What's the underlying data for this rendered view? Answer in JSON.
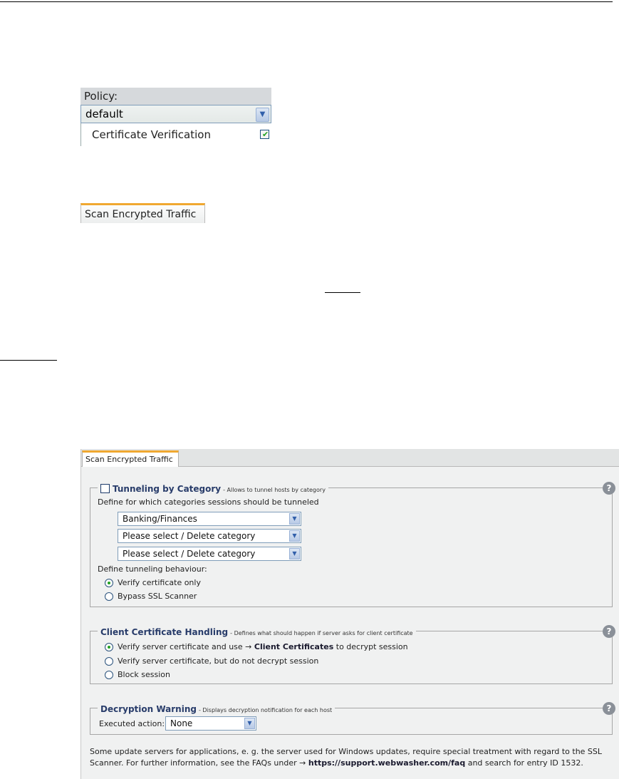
{
  "policy": {
    "header": "Policy:",
    "selected": "default",
    "row_label": "Certificate Verification",
    "row_checked": true
  },
  "small_tab": {
    "label": "Scan Encrypted Traffic"
  },
  "panel": {
    "tab_label": "Scan Encrypted Traffic",
    "tunneling": {
      "title": "Tunneling by Category",
      "desc": "- Allows to tunnel hosts by category",
      "checked": false,
      "define_label": "Define for which categories sessions should be tunneled",
      "categories": [
        "Banking/Finances",
        "Please select / Delete category",
        "Please select / Delete category"
      ],
      "behaviour_label": "Define tunneling behaviour:",
      "options": [
        {
          "label": "Verify certificate only",
          "selected": true
        },
        {
          "label": "Bypass SSL Scanner",
          "selected": false
        }
      ]
    },
    "client_cert": {
      "title": "Client Certificate Handling",
      "desc": "- Defines what should happen if server asks for client certificate",
      "option1_prefix": "Verify server certificate and use →",
      "option1_link": "Client Certificates",
      "option1_suffix": "to decrypt session",
      "option2": "Verify server certificate, but do not decrypt session",
      "option3": "Block session",
      "selected_index": 0
    },
    "decryption": {
      "title": "Decryption Warning",
      "desc": "- Displays decryption notification for each host",
      "action_label": "Executed action:",
      "action_value": "None"
    },
    "note": {
      "line1": "Some update servers for applications, e. g. the server used for Windows updates, require special treatment with regard to the SSL",
      "line2_prefix": "Scanner. For further information, see the FAQs under →",
      "line2_link": "https://support.webwasher.com/faq",
      "line2_suffix": "and search for entry ID 1532."
    }
  }
}
